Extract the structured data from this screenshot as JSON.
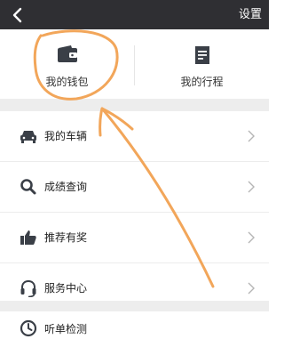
{
  "header": {
    "settings_label": "设置",
    "back_icon": "back-arrow-icon"
  },
  "top_cards": [
    {
      "label": "我的钱包",
      "icon": "wallet-icon"
    },
    {
      "label": "我的行程",
      "icon": "trip-list-icon"
    }
  ],
  "menu": [
    {
      "label": "我的车辆",
      "icon": "car-icon"
    },
    {
      "label": "成绩查询",
      "icon": "search-icon"
    },
    {
      "label": "推荐有奖",
      "icon": "thumbs-up-icon"
    },
    {
      "label": "服务中心",
      "icon": "headset-icon"
    }
  ],
  "bottom_item": {
    "label": "听单检测",
    "icon": "clock-icon"
  },
  "colors": {
    "topbar": "#2f2f33",
    "icon_dark": "#3a3f47",
    "annotation": "#f2a65a",
    "separator": "#ededed"
  }
}
